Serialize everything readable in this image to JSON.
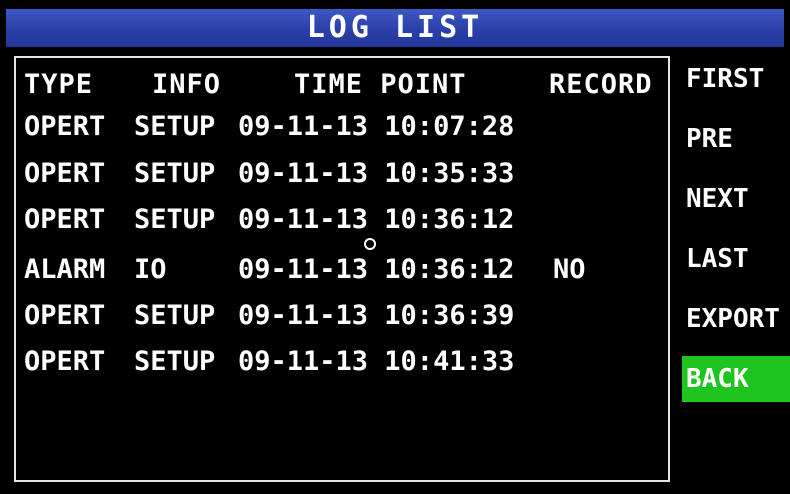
{
  "window": {
    "title": "LOG LIST"
  },
  "table": {
    "columns": [
      "TYPE",
      "INFO",
      "TIME POINT",
      "RECORD"
    ],
    "rows": [
      {
        "type": "OPERT",
        "info": "SETUP",
        "time": "09-11-13 10:07:28",
        "record": ""
      },
      {
        "type": "OPERT",
        "info": "SETUP",
        "time": "09-11-13 10:35:33",
        "record": ""
      },
      {
        "type": "OPERT",
        "info": "SETUP",
        "time": "09-11-13 10:36:12",
        "record": ""
      },
      {
        "type": "ALARM",
        "info": "IO",
        "time": "09-11-13 10:36:12",
        "record": "NO"
      },
      {
        "type": "OPERT",
        "info": "SETUP",
        "time": "09-11-13 10:36:39",
        "record": ""
      },
      {
        "type": "OPERT",
        "info": "SETUP",
        "time": "09-11-13 10:41:33",
        "record": ""
      }
    ]
  },
  "menu": {
    "items": [
      {
        "label": "FIRST",
        "active": false
      },
      {
        "label": "PRE",
        "active": false
      },
      {
        "label": "NEXT",
        "active": false
      },
      {
        "label": "LAST",
        "active": false
      },
      {
        "label": "EXPORT",
        "active": false
      },
      {
        "label": "BACK",
        "active": true
      }
    ]
  },
  "colors": {
    "title_bar": "#2a3fa8",
    "active_button": "#1ec51e",
    "background": "#000000",
    "text": "#ffffff"
  }
}
